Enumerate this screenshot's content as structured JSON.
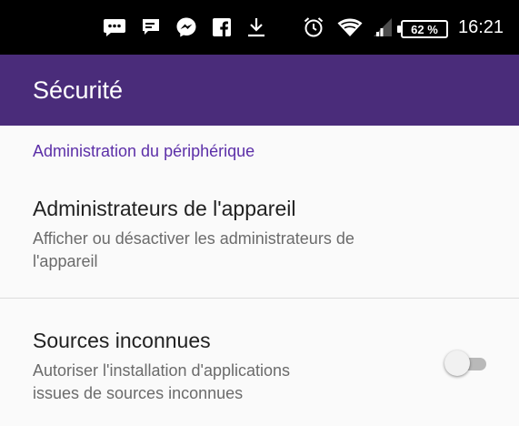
{
  "status_bar": {
    "icons": [
      "sms-icon",
      "message-icon",
      "messenger-icon",
      "facebook-icon",
      "download-icon",
      "alarm-icon",
      "wifi-icon",
      "signal-icon"
    ],
    "battery": "62 %",
    "time": "16:21"
  },
  "toolbar": {
    "title": "Sécurité",
    "color": "#4a2c7a"
  },
  "section": {
    "header": "Administration du périphérique",
    "color": "#5c2fa8"
  },
  "prefs": [
    {
      "title": "Administrateurs de l'appareil",
      "summary_line1": "Afficher ou désactiver les administrateurs de",
      "summary_line2": "l'appareil"
    },
    {
      "title": "Sources inconnues",
      "summary_line1": "Autoriser l'installation d'applications",
      "summary_line2": "issues de sources inconnues",
      "switch_on": false
    }
  ]
}
